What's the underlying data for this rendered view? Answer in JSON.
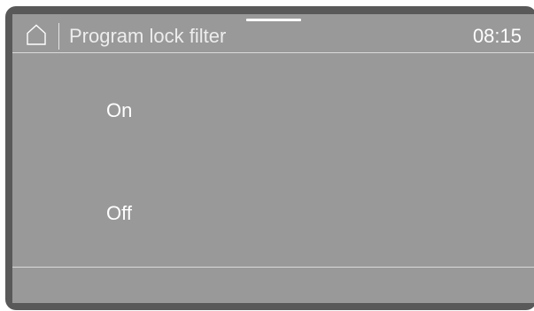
{
  "header": {
    "home_icon": "home-icon",
    "title": "Program lock filter",
    "time": "08:15"
  },
  "options": [
    {
      "label": "On"
    },
    {
      "label": "Off"
    }
  ],
  "colors": {
    "bezel": "#595959",
    "screen": "#999999",
    "text": "#ffffff"
  }
}
